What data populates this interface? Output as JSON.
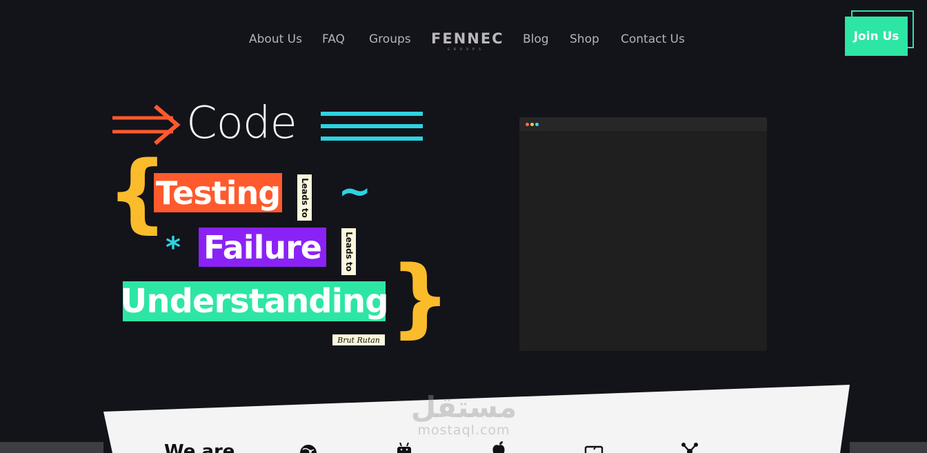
{
  "nav": {
    "items": [
      "About Us",
      "FAQ",
      "Groups",
      "Blog",
      "Shop",
      "Contact Us"
    ],
    "logo_word": "FENNEC",
    "logo_sub": "GROUPS",
    "join_label": "Join Us"
  },
  "hero": {
    "code_word": "Code",
    "tags": [
      "Testing",
      "Failure",
      "Understanding"
    ],
    "connector": "Leads to",
    "author": "Brut Rutan",
    "tilde": "~",
    "asterisk": "*"
  },
  "panel": {
    "heading": "We are",
    "watermark_arabic": "مستقل",
    "watermark_latin": "mostaql.com",
    "icons": [
      "globe-icon",
      "android-icon",
      "apple-icon",
      "monitor-icon",
      "network-icon"
    ]
  },
  "colors": {
    "background": "#13131a",
    "accent_green": "#2ee6a4",
    "accent_orange": "#ff5a2d",
    "accent_purple": "#8a22f5",
    "accent_cyan": "#2dd3e0",
    "accent_yellow": "#fbbc2b",
    "window_bg": "#1f1f20",
    "panel_bg": "#f4f4f4"
  }
}
